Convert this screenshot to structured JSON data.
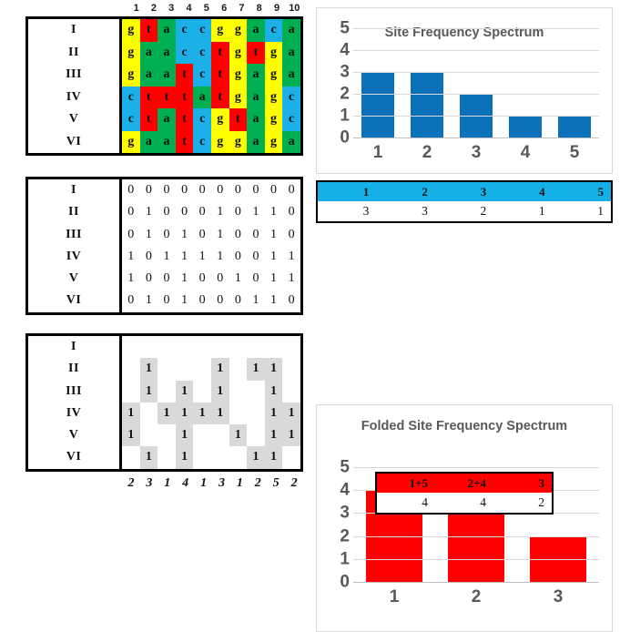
{
  "alignment": {
    "column_headers": [
      "1",
      "2",
      "3",
      "4",
      "5",
      "6",
      "7",
      "8",
      "9",
      "10"
    ],
    "row_labels": [
      "I",
      "II",
      "III",
      "IV",
      "V",
      "VI"
    ],
    "base_colors": {
      "g": "#ffff00",
      "t": "#ff0000",
      "a": "#00b050",
      "c": "#1cb0e8"
    },
    "rows": [
      [
        "g",
        "t",
        "a",
        "c",
        "c",
        "g",
        "g",
        "a",
        "c",
        "a"
      ],
      [
        "g",
        "a",
        "a",
        "c",
        "c",
        "t",
        "g",
        "t",
        "g",
        "a"
      ],
      [
        "g",
        "a",
        "a",
        "t",
        "c",
        "t",
        "g",
        "a",
        "g",
        "a"
      ],
      [
        "c",
        "t",
        "t",
        "t",
        "a",
        "t",
        "g",
        "a",
        "g",
        "c"
      ],
      [
        "c",
        "t",
        "a",
        "t",
        "c",
        "g",
        "t",
        "a",
        "g",
        "c"
      ],
      [
        "g",
        "a",
        "a",
        "t",
        "c",
        "g",
        "g",
        "a",
        "g",
        "a"
      ]
    ]
  },
  "binary_matrix": {
    "row_labels": [
      "I",
      "II",
      "III",
      "IV",
      "V",
      "VI"
    ],
    "rows": [
      [
        "0",
        "0",
        "0",
        "0",
        "0",
        "0",
        "0",
        "0",
        "0",
        "0"
      ],
      [
        "0",
        "1",
        "0",
        "0",
        "0",
        "1",
        "0",
        "1",
        "1",
        "0"
      ],
      [
        "0",
        "1",
        "0",
        "1",
        "0",
        "1",
        "0",
        "0",
        "1",
        "0"
      ],
      [
        "1",
        "0",
        "1",
        "1",
        "1",
        "1",
        "0",
        "0",
        "1",
        "1"
      ],
      [
        "1",
        "0",
        "0",
        "1",
        "0",
        "0",
        "1",
        "0",
        "1",
        "1"
      ],
      [
        "0",
        "1",
        "0",
        "1",
        "0",
        "0",
        "0",
        "1",
        "1",
        "0"
      ]
    ]
  },
  "shaded_matrix": {
    "row_labels": [
      "I",
      "II",
      "III",
      "IV",
      "V",
      "VI"
    ],
    "rows": [
      [
        "",
        "",
        "",
        "",
        "",
        "",
        "",
        "",
        "",
        ""
      ],
      [
        "",
        "1",
        "",
        "",
        "",
        "1",
        "",
        "1",
        "1",
        ""
      ],
      [
        "",
        "1",
        "",
        "1",
        "",
        "1",
        "",
        "",
        "1",
        ""
      ],
      [
        "1",
        "",
        "1",
        "1",
        "1",
        "1",
        "",
        "",
        "1",
        "1"
      ],
      [
        "1",
        "",
        "",
        "1",
        "",
        "",
        "1",
        "",
        "1",
        "1"
      ],
      [
        "",
        "1",
        "",
        "1",
        "",
        "",
        "",
        "1",
        "1",
        ""
      ]
    ],
    "column_sums": [
      "2",
      "3",
      "1",
      "4",
      "1",
      "3",
      "1",
      "2",
      "5",
      "2"
    ]
  },
  "chart_data": [
    {
      "type": "bar",
      "id": "site-frequency-spectrum",
      "title": "Site Frequency Spectrum",
      "categories": [
        "1",
        "2",
        "3",
        "4",
        "5"
      ],
      "values": [
        3,
        3,
        2,
        1,
        1
      ],
      "ylim": [
        0,
        5
      ],
      "yticks": [
        "0",
        "1",
        "2",
        "3",
        "4",
        "5"
      ],
      "xlabel": "",
      "ylabel": "",
      "grid": true,
      "legend": "none",
      "bar_color": "#0b72b9"
    },
    {
      "type": "bar",
      "id": "folded-site-frequency-spectrum",
      "title": "Folded Site Frequency Spectrum",
      "categories": [
        "1",
        "2",
        "3"
      ],
      "values": [
        4,
        4,
        2
      ],
      "ylim": [
        0,
        5
      ],
      "yticks": [
        "0",
        "1",
        "2",
        "3",
        "4",
        "5"
      ],
      "xlabel": "",
      "ylabel": "",
      "grid": true,
      "legend": "none",
      "bar_color": "#ff0000"
    }
  ],
  "sfs_table": {
    "headers": [
      "1",
      "2",
      "3",
      "4",
      "5"
    ],
    "values": [
      "3",
      "3",
      "2",
      "1",
      "1"
    ],
    "header_color": "#15b0e8"
  },
  "folded_table": {
    "headers": [
      "1+5",
      "2+4",
      "3"
    ],
    "values": [
      "4",
      "4",
      "2"
    ],
    "header_color": "#ff0000"
  }
}
